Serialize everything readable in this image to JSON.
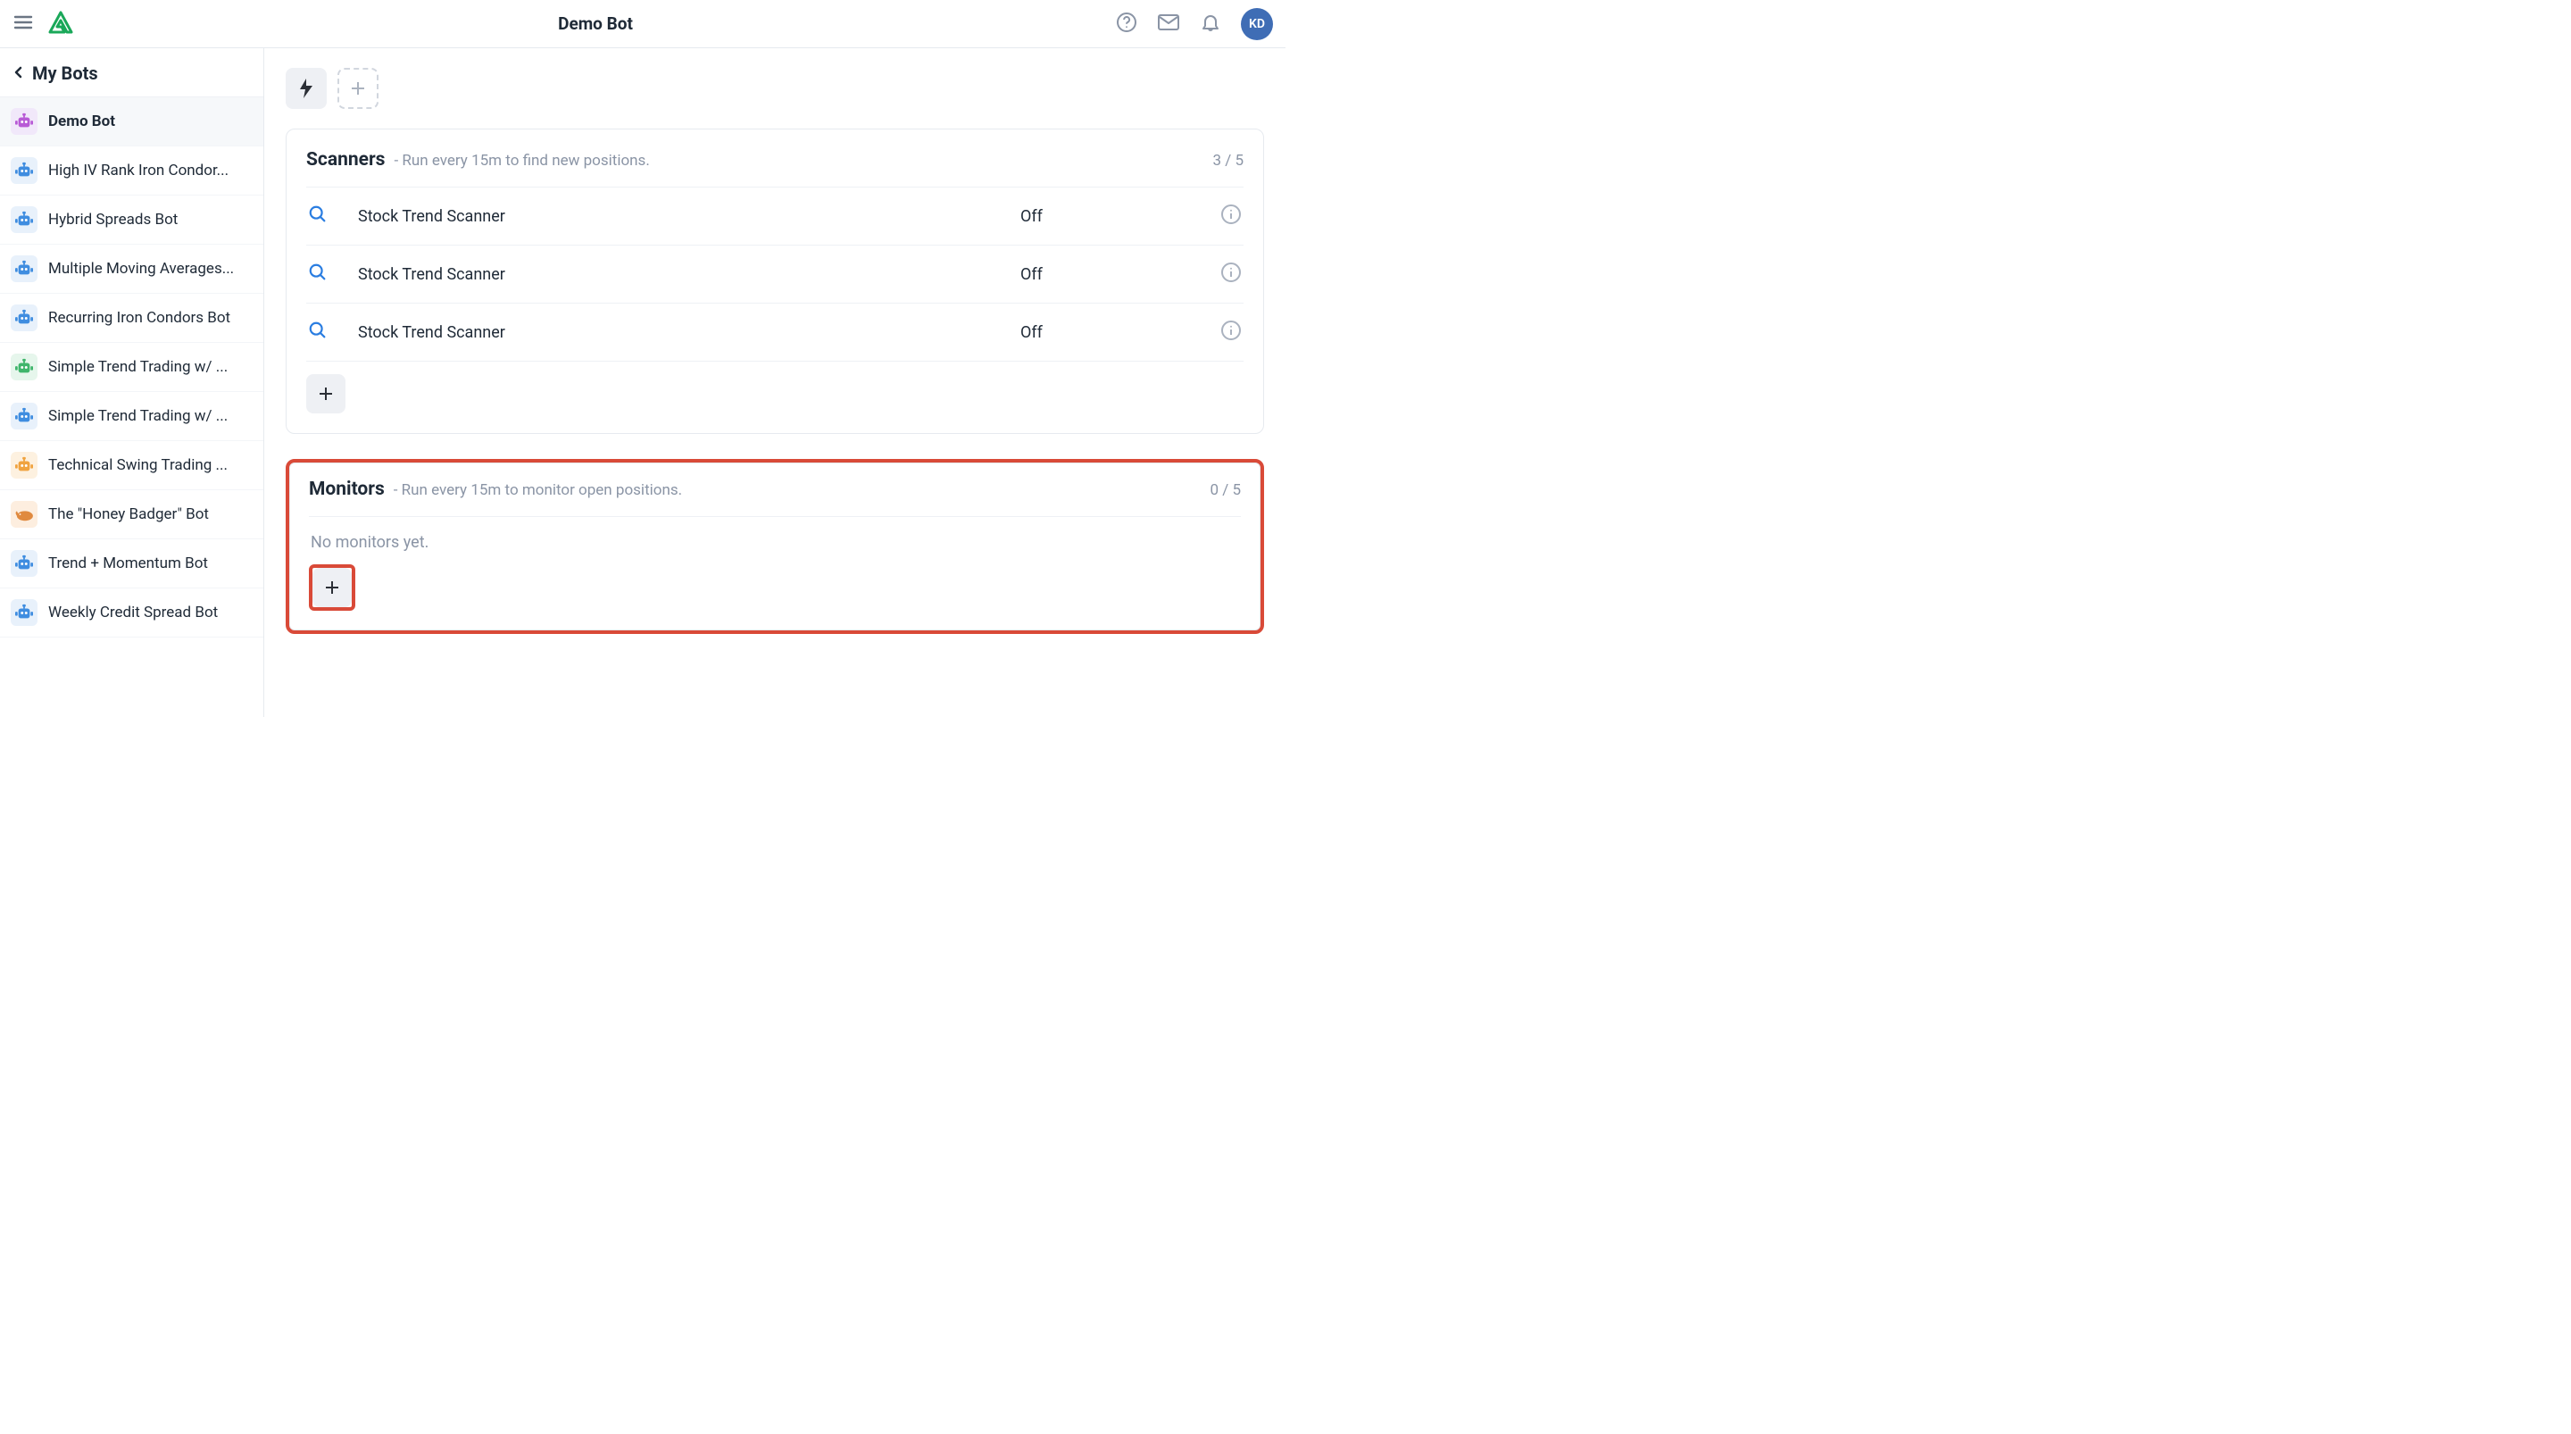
{
  "header": {
    "title": "Demo Bot",
    "avatar": "KD"
  },
  "sidebar": {
    "title": "My Bots",
    "items": [
      {
        "label": "Demo Bot",
        "active": true,
        "icon_color": "#b85ad6",
        "icon_bg": "#f1e8fa"
      },
      {
        "label": "High IV Rank Iron Condor...",
        "active": false,
        "icon_color": "#3f8de0",
        "icon_bg": "#e8f1fb"
      },
      {
        "label": "Hybrid Spreads Bot",
        "active": false,
        "icon_color": "#3f8de0",
        "icon_bg": "#e8f1fb"
      },
      {
        "label": "Multiple Moving Averages...",
        "active": false,
        "icon_color": "#3f8de0",
        "icon_bg": "#e8f1fb"
      },
      {
        "label": "Recurring Iron Condors Bot",
        "active": false,
        "icon_color": "#3f8de0",
        "icon_bg": "#e8f1fb"
      },
      {
        "label": "Simple Trend Trading w/ ...",
        "active": false,
        "icon_color": "#3fb56b",
        "icon_bg": "#e6f6ec"
      },
      {
        "label": "Simple Trend Trading w/ ...",
        "active": false,
        "icon_color": "#3f8de0",
        "icon_bg": "#e8f1fb"
      },
      {
        "label": "Technical Swing Trading ...",
        "active": false,
        "icon_color": "#f0a33f",
        "icon_bg": "#fdf1e0"
      },
      {
        "label": "The \"Honey Badger\" Bot",
        "active": false,
        "icon_color": "#e08a3f",
        "icon_bg": "#fdeedf",
        "variant": "badger"
      },
      {
        "label": "Trend + Momentum Bot",
        "active": false,
        "icon_color": "#3f8de0",
        "icon_bg": "#e8f1fb"
      },
      {
        "label": "Weekly Credit Spread Bot",
        "active": false,
        "icon_color": "#3f8de0",
        "icon_bg": "#e8f1fb"
      }
    ]
  },
  "scanners": {
    "title": "Scanners",
    "subtitle": "- Run every 15m to find new positions.",
    "count": "3 / 5",
    "rows": [
      {
        "name": "Stock Trend Scanner",
        "status": "Off"
      },
      {
        "name": "Stock Trend Scanner",
        "status": "Off"
      },
      {
        "name": "Stock Trend Scanner",
        "status": "Off"
      }
    ]
  },
  "monitors": {
    "title": "Monitors",
    "subtitle": "- Run every 15m to monitor open positions.",
    "count": "0 / 5",
    "empty": "No monitors yet."
  }
}
